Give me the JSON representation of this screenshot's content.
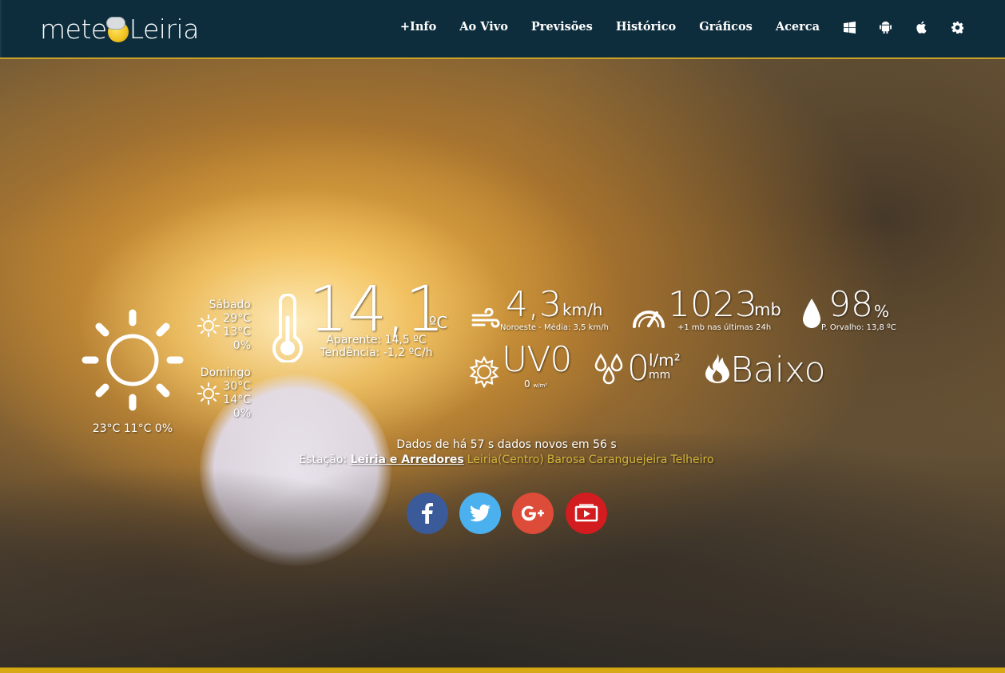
{
  "brand": {
    "logo_left": "mete",
    "logo_right": "Leiria"
  },
  "nav": {
    "items": [
      "+Info",
      "Ao Vivo",
      "Previsões",
      "Histórico",
      "Gráficos",
      "Acerca"
    ],
    "icons": [
      "windows-icon",
      "android-icon",
      "apple-icon",
      "gear-icon"
    ]
  },
  "today": {
    "summary": "23°C 11°C 0%",
    "icon": "sun-icon"
  },
  "forecast": [
    {
      "day": "Sábado",
      "max": "29°C",
      "min": "13°C",
      "precip": "0%",
      "icon": "sun-icon"
    },
    {
      "day": "Domingo",
      "max": "30°C",
      "min": "14°C",
      "precip": "0%",
      "icon": "sun-icon"
    }
  ],
  "temperature": {
    "value": "14,1",
    "unit": "ºC",
    "apparent": "Aparente: 14,5 ºC",
    "trend": "Tendência: -1,2 ºC/h"
  },
  "wind": {
    "value": "4,3",
    "unit": "km/h",
    "desc": "Noroeste - Média: 3,5 km/h"
  },
  "pressure": {
    "value": "1023",
    "unit": "mb",
    "desc": "+1 mb nas últimas 24h"
  },
  "humidity": {
    "value": "98",
    "unit": "%",
    "desc": "P. Orvalho: 13,8 ºC"
  },
  "uv": {
    "label": "UV",
    "value": "0",
    "sub_value": "0",
    "sub_unit": "w/m²"
  },
  "rain": {
    "value": "0",
    "unit_top": "l/m²",
    "unit_bottom": "mm"
  },
  "fire_risk": {
    "value": "Baixo"
  },
  "status": "Dados de há 57 s dados novos em 56 s",
  "stations": {
    "label": "Estação:",
    "active": "Leiria e Arredores",
    "others": [
      "Leiria(Centro)",
      "Barosa",
      "Caranguejeira",
      "Telheiro"
    ]
  },
  "social": [
    "facebook-icon",
    "twitter-icon",
    "google-plus-icon",
    "youtube-icon"
  ],
  "colors": {
    "navbar": "#0d2d3d",
    "accent_yellow": "#d6a915",
    "station_link": "#d4b43a",
    "facebook": "#3b5a9a",
    "twitter": "#4bb0ee",
    "google_plus": "#dd4b39",
    "youtube": "#d31c20"
  }
}
